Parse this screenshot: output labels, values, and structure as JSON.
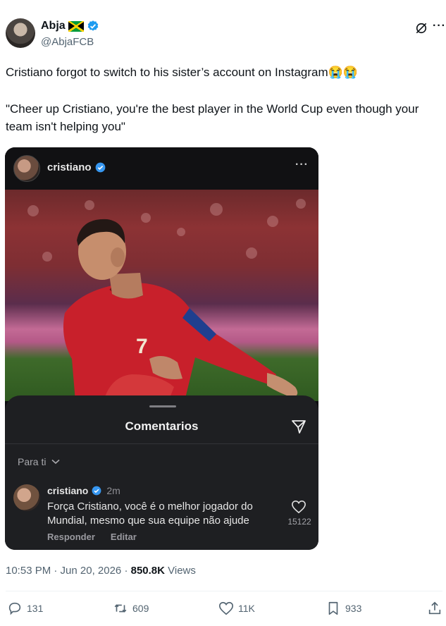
{
  "author": {
    "name": "Abja",
    "handle": "@AbjaFCB",
    "verified": true
  },
  "tweet": {
    "line1": "Cristiano forgot to switch to his sister’s account on Instagram😭😭",
    "line2": "\"Cheer up Cristiano, you're the best player in the World Cup even though your team isn't helping you\""
  },
  "media": {
    "username": "cristiano",
    "comments_title": "Comentarios",
    "filter_label": "Para ti",
    "comment": {
      "username": "cristiano",
      "time": "2m",
      "text": "Força Cristiano, você é o melhor jogador do Mundial, mesmo que sua equipe não ajude",
      "reply_label": "Responder",
      "edit_label": "Editar",
      "likes": "15122"
    }
  },
  "meta": {
    "timestamp": "10:53 PM · Jun 20, 2026 · ",
    "views_count": "850.8K",
    "views_label": " Views"
  },
  "actions": {
    "replies": "131",
    "reposts": "609",
    "likes": "11K",
    "bookmarks": "933"
  },
  "colors": {
    "verified_blue": "#1d9bf0",
    "text_primary": "#0f1419",
    "text_secondary": "#536471"
  }
}
